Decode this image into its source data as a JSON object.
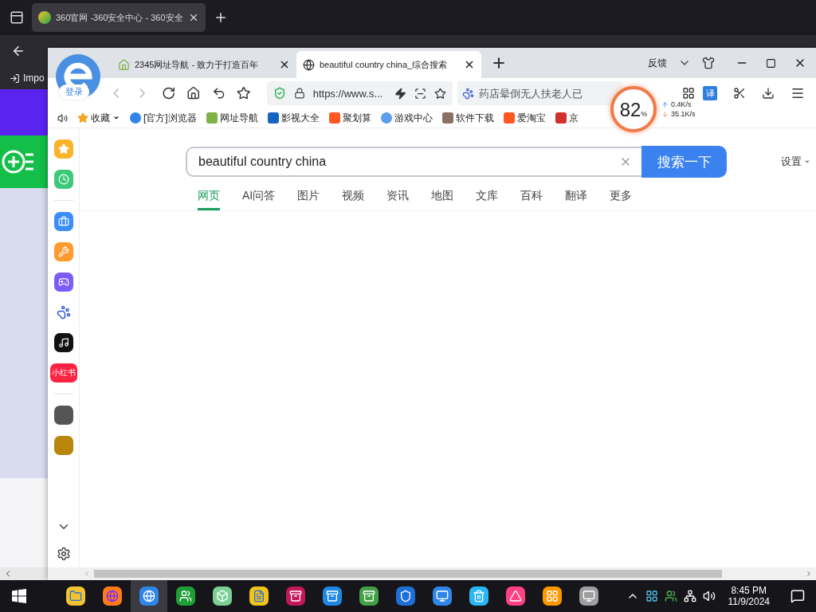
{
  "back_window": {
    "tab_title": "360官网 -360安全中心 - 360安全",
    "bookmark": "Impo"
  },
  "window": {
    "tabs": [
      {
        "title": "2345网址导航 - 致力于打造百年",
        "selected": false
      },
      {
        "title": "beautiful country china_综合搜索",
        "selected": true
      }
    ],
    "feedback": "反馈",
    "login_badge": "登录"
  },
  "address_bar": {
    "url": "https://www.s..."
  },
  "hot_search": {
    "placeholder": "药店晕倒无人扶老人已"
  },
  "translate_button": "译",
  "bookmarks": [
    {
      "label": "收藏"
    },
    {
      "label": "[官方]浏览器"
    },
    {
      "label": "网址导航"
    },
    {
      "label": "影视大全"
    },
    {
      "label": "聚划算"
    },
    {
      "label": "游戏中心"
    },
    {
      "label": "软件下载"
    },
    {
      "label": "爱淘宝"
    },
    {
      "label": "京"
    }
  ],
  "speed_meter": {
    "percent": "82",
    "unit": "%",
    "upload": "0.4K/s",
    "download": "35.1K/s"
  },
  "sidebar": {
    "badge": "小红书"
  },
  "search": {
    "query": "beautiful country china",
    "button": "搜索一下",
    "settings": "设置"
  },
  "result_tabs": [
    {
      "label": "网页",
      "selected": true
    },
    {
      "label": "AI问答",
      "selected": false
    },
    {
      "label": "图片",
      "selected": false
    },
    {
      "label": "视频",
      "selected": false
    },
    {
      "label": "资讯",
      "selected": false
    },
    {
      "label": "地图",
      "selected": false
    },
    {
      "label": "文库",
      "selected": false
    },
    {
      "label": "百科",
      "selected": false
    },
    {
      "label": "翻译",
      "selected": false
    },
    {
      "label": "更多",
      "selected": false
    }
  ],
  "taskbar": {
    "time": "8:45 PM",
    "date": "11/9/2024"
  }
}
